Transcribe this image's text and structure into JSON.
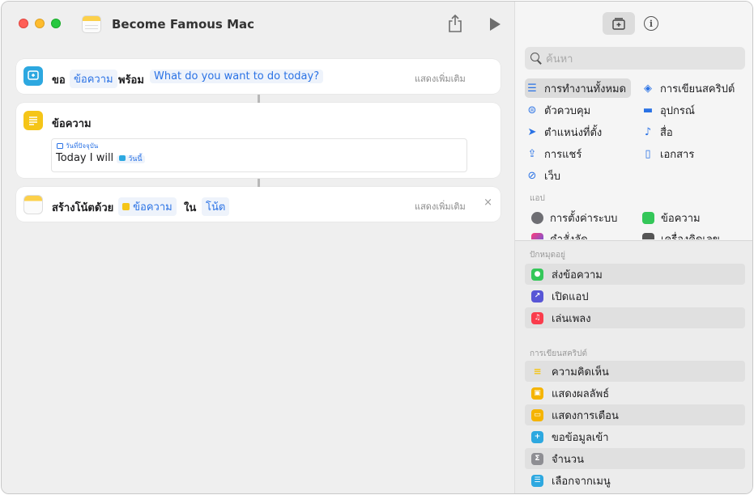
{
  "window": {
    "title": "Become Famous Mac",
    "colors": {
      "close": "#ff5f57",
      "minimize": "#febc2e",
      "zoom": "#28c840",
      "accent": "#2a72e5"
    }
  },
  "toolbar": {
    "share_icon": "share-icon",
    "run_icon": "play-icon"
  },
  "actions": {
    "ask": {
      "verb": "ขอ",
      "token_type": "ข้อความ",
      "with": "พร้อม",
      "prompt": "What do you want to do today?",
      "show_more": "แสดงเพิ่มเติม"
    },
    "text": {
      "title": "ข้อความ",
      "date_token": "วันที่ปัจจุบัน",
      "content": "Today I will",
      "inline_token": "วันนี้"
    },
    "note": {
      "verb": "สร้างโน้ตด้วย",
      "token_text": "ข้อความ",
      "in": "ใน",
      "token_notes": "โน้ต",
      "show_more": "แสดงเพิ่มเติม",
      "close": "×"
    }
  },
  "sidebar": {
    "search_placeholder": "ค้นหา",
    "categories": [
      {
        "label": "การทำงานทั้งหมด",
        "icon": "list-icon",
        "selected": true
      },
      {
        "label": "การเขียนสคริปต์",
        "icon": "script-icon"
      },
      {
        "label": "ตัวควบคุม",
        "icon": "toggle-icon"
      },
      {
        "label": "อุปกรณ์",
        "icon": "display-icon"
      },
      {
        "label": "ตำแหน่งที่ตั้ง",
        "icon": "location-arrow-icon"
      },
      {
        "label": "สื่อ",
        "icon": "music-note-icon"
      },
      {
        "label": "การแชร์",
        "icon": "share-icon"
      },
      {
        "label": "เอกสาร",
        "icon": "document-icon"
      },
      {
        "label": "เว็บ",
        "icon": "compass-icon"
      }
    ],
    "apps_label": "แอป",
    "apps": [
      {
        "label": "การตั้งค่าระบบ",
        "icon": "settings-gear-icon"
      },
      {
        "label": "ข้อความ",
        "icon": "messages-icon"
      },
      {
        "label": "คำสั่งลัด",
        "icon": "shortcuts-icon"
      },
      {
        "label": "เครื่องคิดเลข",
        "icon": "calculator-icon"
      }
    ],
    "pinned_label": "ปักหมุดอยู่",
    "pinned": [
      {
        "label": "ส่งข้อความ",
        "icon": "messages-icon",
        "color": "#34c759"
      },
      {
        "label": "เปิดแอป",
        "icon": "open-app-icon",
        "color": "#5856d6"
      },
      {
        "label": "เล่นเพลง",
        "icon": "music-icon",
        "color": "#fa3c4c"
      }
    ],
    "scripting_label": "การเขียนสคริปต์",
    "scripting": [
      {
        "label": "ความคิดเห็น",
        "icon": "comment-lines-icon",
        "color": "#f5c518"
      },
      {
        "label": "แสดงผลลัพธ์",
        "icon": "show-result-icon",
        "color": "#f5b400"
      },
      {
        "label": "แสดงการเตือน",
        "icon": "alert-icon",
        "color": "#f5b400"
      },
      {
        "label": "ขอข้อมูลเข้า",
        "icon": "ask-input-icon",
        "color": "#2da8e0"
      },
      {
        "label": "จำนวน",
        "icon": "sigma-icon",
        "color": "#8e8e93"
      },
      {
        "label": "เลือกจากเมนู",
        "icon": "menu-icon",
        "color": "#2da8e0"
      }
    ]
  }
}
